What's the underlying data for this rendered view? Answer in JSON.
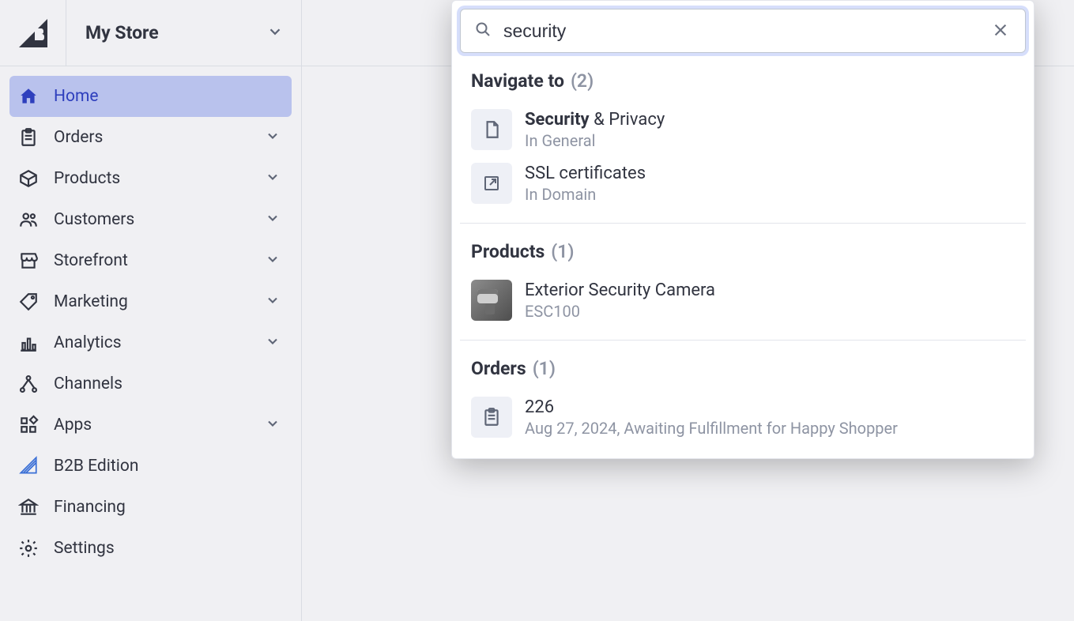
{
  "store": {
    "name": "My Store"
  },
  "sidebar": {
    "items": [
      {
        "label": "Home",
        "icon": "home",
        "chevron": false,
        "active": true
      },
      {
        "label": "Orders",
        "icon": "clipboard",
        "chevron": true
      },
      {
        "label": "Products",
        "icon": "box",
        "chevron": true
      },
      {
        "label": "Customers",
        "icon": "people",
        "chevron": true
      },
      {
        "label": "Storefront",
        "icon": "storefront",
        "chevron": true
      },
      {
        "label": "Marketing",
        "icon": "tag",
        "chevron": true
      },
      {
        "label": "Analytics",
        "icon": "bars",
        "chevron": true
      },
      {
        "label": "Channels",
        "icon": "channels",
        "chevron": false
      },
      {
        "label": "Apps",
        "icon": "apps",
        "chevron": true
      },
      {
        "label": "B2B Edition",
        "icon": "b2b",
        "chevron": false
      },
      {
        "label": "Financing",
        "icon": "bank",
        "chevron": false
      },
      {
        "label": "Settings",
        "icon": "gear",
        "chevron": false
      }
    ]
  },
  "search": {
    "query": "security"
  },
  "groups": {
    "navigate": {
      "title": "Navigate to",
      "count": "(2)",
      "items": [
        {
          "title_hl": "Security",
          "title_rest": " & Privacy",
          "sub": "In General",
          "icon": "page"
        },
        {
          "title": "SSL certificates",
          "sub": "In Domain",
          "icon": "external"
        }
      ]
    },
    "products": {
      "title": "Products",
      "count": "(1)",
      "items": [
        {
          "title": "Exterior Security Camera",
          "sub": "ESC100",
          "thumb": "image"
        }
      ]
    },
    "orders": {
      "title": "Orders",
      "count": "(1)",
      "items": [
        {
          "title": "226",
          "sub": "Aug 27, 2024, Awaiting Fulfillment for Happy Shopper",
          "icon": "clipboard"
        }
      ]
    }
  }
}
